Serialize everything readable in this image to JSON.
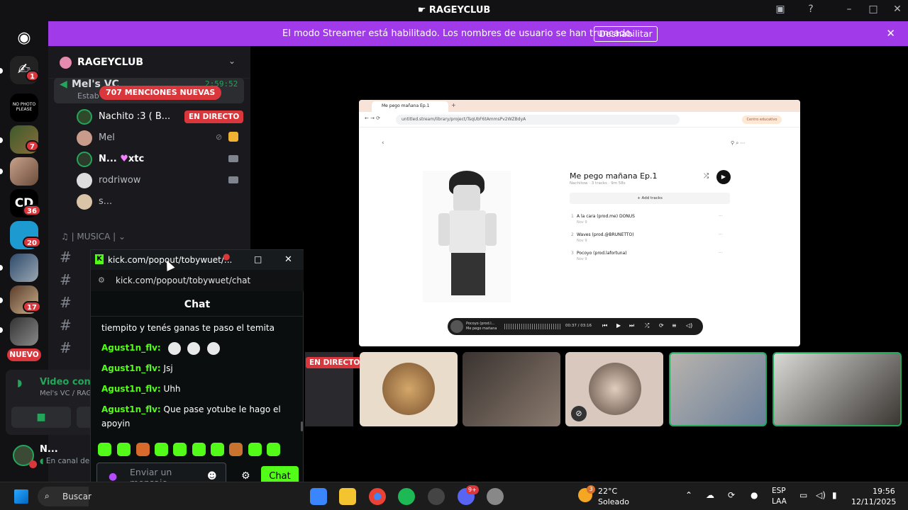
{
  "window": {
    "title": "RAGEYCLUB"
  },
  "banner": {
    "text": "El modo Streamer está habilitado. Los nombres de usuario se han truncado.",
    "button": "Deshabilitar"
  },
  "server_badges": [
    "1",
    "7",
    "36",
    "20",
    "17"
  ],
  "server_new_label": "NUEVO",
  "server_cd_label": "CD",
  "server_nophoto_label": "NO PHOTO PLEASE",
  "guild": {
    "name": "RAGEYCLUB",
    "voice_channel": "Mel's VC",
    "timer": "2:59:52",
    "sub": "Estab",
    "mentions": "707 MENCIONES NUEVAS",
    "members": [
      {
        "name": "Nachito :3 ( B...",
        "live": "EN DIRECTO"
      },
      {
        "name": "Mel"
      },
      {
        "name": "N...",
        "extra": "xtc"
      },
      {
        "name": "rodriwow"
      },
      {
        "name": "s..."
      }
    ],
    "category": "| MUSICA |"
  },
  "voice_panel": {
    "status": "Video cone",
    "sub": "Mel's VC / RAG"
  },
  "user_panel": {
    "name": "N...",
    "status": "En canal de"
  },
  "stream": {
    "tab_title": "Me pego mañana Ep.1",
    "url": "untitled.stream/library/project/TsqUbF6tAmmsPv2WZBdyA",
    "edu_label": "Centro educativo",
    "playlist_title": "Me pego mañana Ep.1",
    "playlist_sub": "Nachitow · 3 tracks · 9m 58s",
    "add_tracks": "+ Add tracks",
    "tracks": [
      {
        "num": "1",
        "title": "A la cara (prod.me) DONUS",
        "date": "Nov 9"
      },
      {
        "num": "2",
        "title": "Waves (prod.@BRUNETTO)",
        "date": "Nov 9"
      },
      {
        "num": "3",
        "title": "Pocoyo (prod.lafortuna)",
        "date": "Nov 9"
      }
    ],
    "player": {
      "track": "Pocoyo (prod.l...",
      "playlist": "Me pego mañana",
      "time": "00:37 / 03:16"
    }
  },
  "tiles": {
    "live_label": "EN DIRECTO"
  },
  "popout": {
    "title": "kick.com/popout/tobywuet/...",
    "url": "kick.com/popout/tobywuet/chat",
    "header": "Chat",
    "messages": [
      {
        "user": "",
        "text": "tiempito y tenés ganas te paso el temita"
      },
      {
        "user": "Agust1n_flv:",
        "text": ""
      },
      {
        "user": "Agust1n_flv:",
        "text": "Jsj"
      },
      {
        "user": "Agust1n_flv:",
        "text": "Uhh"
      },
      {
        "user": "Agust1n_flv:",
        "text": "Que pase yotube le hago el apoyin"
      }
    ],
    "input_placeholder": "Enviar un mensaje",
    "send_button": "Chat"
  },
  "taskbar": {
    "search": "Buscar",
    "chrome_badge": "",
    "discord_badge": "9+",
    "weather_badge": "3",
    "temp": "22°C",
    "weather": "Soleado",
    "lang1": "ESP",
    "lang2": "LAA",
    "time": "19:56",
    "date": "12/11/2025"
  }
}
